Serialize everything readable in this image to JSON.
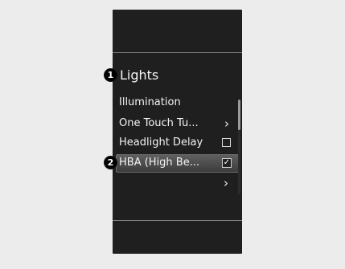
{
  "panel": {
    "title": "Lights",
    "items": [
      {
        "label": "Illumination"
      },
      {
        "label": "One Touch Tu...",
        "trailing_icon": "chevron-right-icon"
      },
      {
        "label": "Headlight Delay",
        "trailing_icon": "checkbox-empty-icon"
      },
      {
        "label": "HBA (High Be...",
        "trailing_icon": "checkbox-checked-icon",
        "selected": true
      }
    ],
    "extra_row_icon": "chevron-right-icon"
  },
  "callouts": {
    "one": "1",
    "two": "2"
  },
  "colors": {
    "background": "#ececec",
    "panel": "#1f1f1f",
    "text": "#f3f3f3",
    "highlight": "#4c4c4c",
    "scroll_thumb": "#9b9b9b"
  }
}
